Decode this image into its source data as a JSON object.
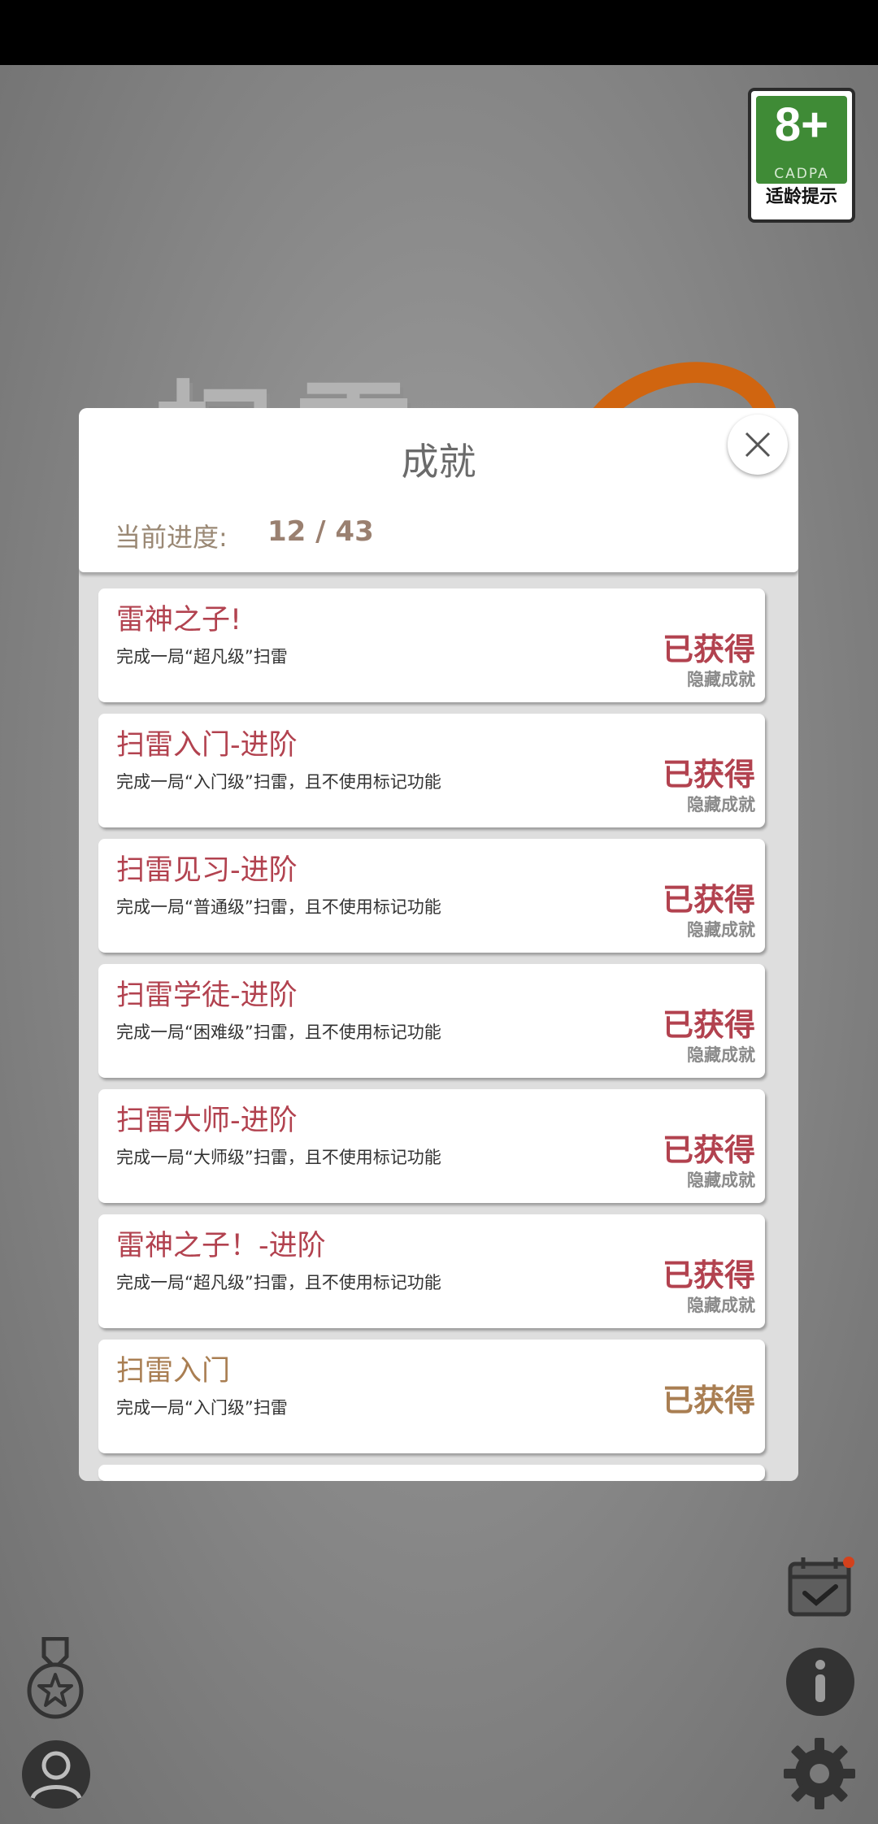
{
  "age_rating": {
    "number": "8+",
    "org": "CADPA",
    "tip": "适龄提示"
  },
  "modal": {
    "title": "成就",
    "progress_label": "当前进度:",
    "progress_value": "12 / 43"
  },
  "achievements": [
    {
      "name": "雷神之子!",
      "desc": "完成一局“超凡级”扫雷",
      "status": "已获得",
      "tag": "隐藏成就"
    },
    {
      "name": "扫雷入门-进阶",
      "desc": "完成一局“入门级”扫雷，且不使用标记功能",
      "status": "已获得",
      "tag": "隐藏成就"
    },
    {
      "name": "扫雷见习-进阶",
      "desc": "完成一局“普通级”扫雷，且不使用标记功能",
      "status": "已获得",
      "tag": "隐藏成就"
    },
    {
      "name": "扫雷学徒-进阶",
      "desc": "完成一局“困难级”扫雷，且不使用标记功能",
      "status": "已获得",
      "tag": "隐藏成就"
    },
    {
      "name": "扫雷大师-进阶",
      "desc": "完成一局“大师级”扫雷，且不使用标记功能",
      "status": "已获得",
      "tag": "隐藏成就"
    },
    {
      "name": "雷神之子！-进阶",
      "desc": "完成一局“超凡级”扫雷，且不使用标记功能",
      "status": "已获得",
      "tag": "隐藏成就"
    },
    {
      "name": "扫雷入门",
      "desc": "完成一局“入门级”扫雷",
      "status": "已获得",
      "tag": ""
    }
  ],
  "colors": {
    "hidden_accent": "#b2424f",
    "normal_accent": "#a97e52",
    "badge_green": "#3f8b36"
  },
  "icons": [
    "close-icon",
    "medal-icon",
    "profile-icon",
    "calendar-check-icon",
    "info-icon",
    "gear-icon"
  ]
}
